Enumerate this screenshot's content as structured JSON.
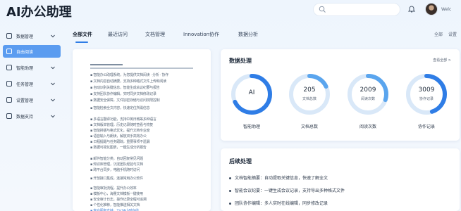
{
  "app": {
    "title": "AI办公助理"
  },
  "header": {
    "search_placeholder": "",
    "user_name": "Welc"
  },
  "sidebar": {
    "items": [
      {
        "label": "数据管理",
        "icon": "dashboard-icon",
        "has_chevron": true
      },
      {
        "label": "自由阅读",
        "icon": "folder-icon",
        "active": true
      },
      {
        "label": "智能助理",
        "icon": "assistant-icon",
        "has_chevron": true
      },
      {
        "label": "任务管理",
        "icon": "task-icon",
        "has_chevron": true
      },
      {
        "label": "设置管理",
        "icon": "settings-icon",
        "has_chevron": true
      },
      {
        "label": "数据支持",
        "icon": "support-icon",
        "has_chevron": true
      }
    ]
  },
  "tabs": {
    "items": [
      "全部文件",
      "最近访问",
      "文档管理",
      "Innovation协作",
      "数据分析"
    ],
    "right": [
      "全部",
      "设置"
    ]
  },
  "document": {
    "lines": [
      "▪ 智能办公助理系统，为您提供文档阅读 · 分析 · 协作",
      "▪ 文档内容自动摘要，支持多种格式文件上传和阅读",
      "▪ 自动识别关键信息，智能生成会议纪要与报告",
      "▪ 支持团队协作编辑，实时同步文档修改记录",
      "▪ 数据安全保障，文件加密存储与访问权限控制",
      "▪ 智能检索全文内容，快速定位所需信息",
      "▪ 多语言翻译功能，支持中英日韩等多种语言",
      "▪ 文档版本管理，历史记录随时查看与恢复",
      "▪ 智能排版与格式优化，提升文档专业度",
      "▪ 语音输入与朗读，解放双手高效办公",
      "▪ 日程提醒与任务跟踪，重要事项不遗漏",
      "▪ 数据可视化图表，一键生成分析报告",
      "▪ 邮件智能分类，自动回复常见问题",
      "▪ 知识库管理，沉淀团队经验与文档",
      "▪ 跨平台同步，电脑手机随时访问",
      "▪ 开放接口集成，连接常用办公软件",
      "▪ 智能审批流程，提升办公效率",
      "▪ 模板中心，海量文档模板一键使用",
      "▪ 安全审计日志，操作记录全程可追溯",
      "▪ 个性化推荐，智能推送相关文档",
      "▪ 客户服务支持，7×24小时在线",
      "▪ 更多功能持续更新中，敬请期待"
    ]
  },
  "stats": {
    "title": "数据处理",
    "view_all": "查看全部 >",
    "rings": [
      {
        "value": "AI",
        "sub": "",
        "label": "智能助理",
        "percent": 68,
        "color": "#2f7de6"
      },
      {
        "value": "205",
        "sub": "文档总数",
        "label": "文档总数",
        "percent": 18,
        "color": "#5aa5ee"
      },
      {
        "value": "2009",
        "sub": "阅读次数",
        "label": "阅读次数",
        "percent": 30,
        "color": "#5aa5ee"
      },
      {
        "value": "3009",
        "sub": "协作记录",
        "label": "协作记录",
        "percent": 45,
        "color": "#2f7de6"
      }
    ]
  },
  "tasks": {
    "title": "后续处理",
    "items": [
      "文档智能摘要：自动提取关键信息，快速了解全文",
      "智能会议纪要：一键生成会议记录，支持导出多种格式文件",
      "团队协作编辑：多人实时在线编辑，同步修改记录"
    ]
  }
}
